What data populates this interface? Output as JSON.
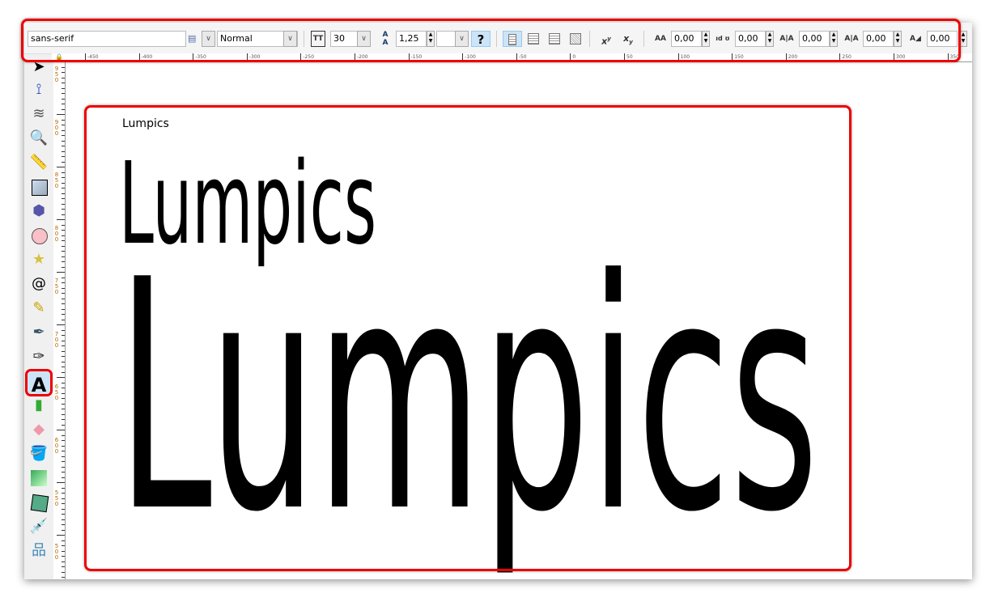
{
  "toolbar": {
    "font_family": "sans-serif",
    "font_style": "Normal",
    "font_size": "30",
    "line_spacing": "1,25",
    "unit_select": "",
    "help_label": "?",
    "superscript_label": "x",
    "subscript_label": "x",
    "letter_spacing": "0,00",
    "word_spacing": "0,00",
    "kerning": "0,00",
    "vertical_shift": "0,00",
    "rotation": "0,00"
  },
  "rulers": {
    "horizontal": [
      "-450",
      "-400",
      "-350",
      "-300",
      "-250",
      "-200",
      "-150",
      "-100",
      "-50",
      "0",
      "50",
      "100",
      "150",
      "200",
      "250",
      "300",
      "350"
    ],
    "vertical": [
      "950",
      "900",
      "850",
      "800",
      "750",
      "700",
      "650",
      "600",
      "550",
      "500"
    ]
  },
  "tools": [
    "selector",
    "node",
    "tweak",
    "zoom",
    "measure",
    "rectangle",
    "3d-box",
    "ellipse",
    "star",
    "spiral",
    "pencil",
    "pen",
    "calligraphy",
    "text",
    "spray",
    "eraser",
    "paint-bucket",
    "gradient",
    "mesh",
    "dropper",
    "connector"
  ],
  "active_tool": "text",
  "canvas": {
    "texts": [
      "Lumpics",
      "Lumpics",
      "Lumpics"
    ]
  },
  "colors": {
    "highlight": "#e00000",
    "active_tool_bg": "#cce4f7"
  }
}
